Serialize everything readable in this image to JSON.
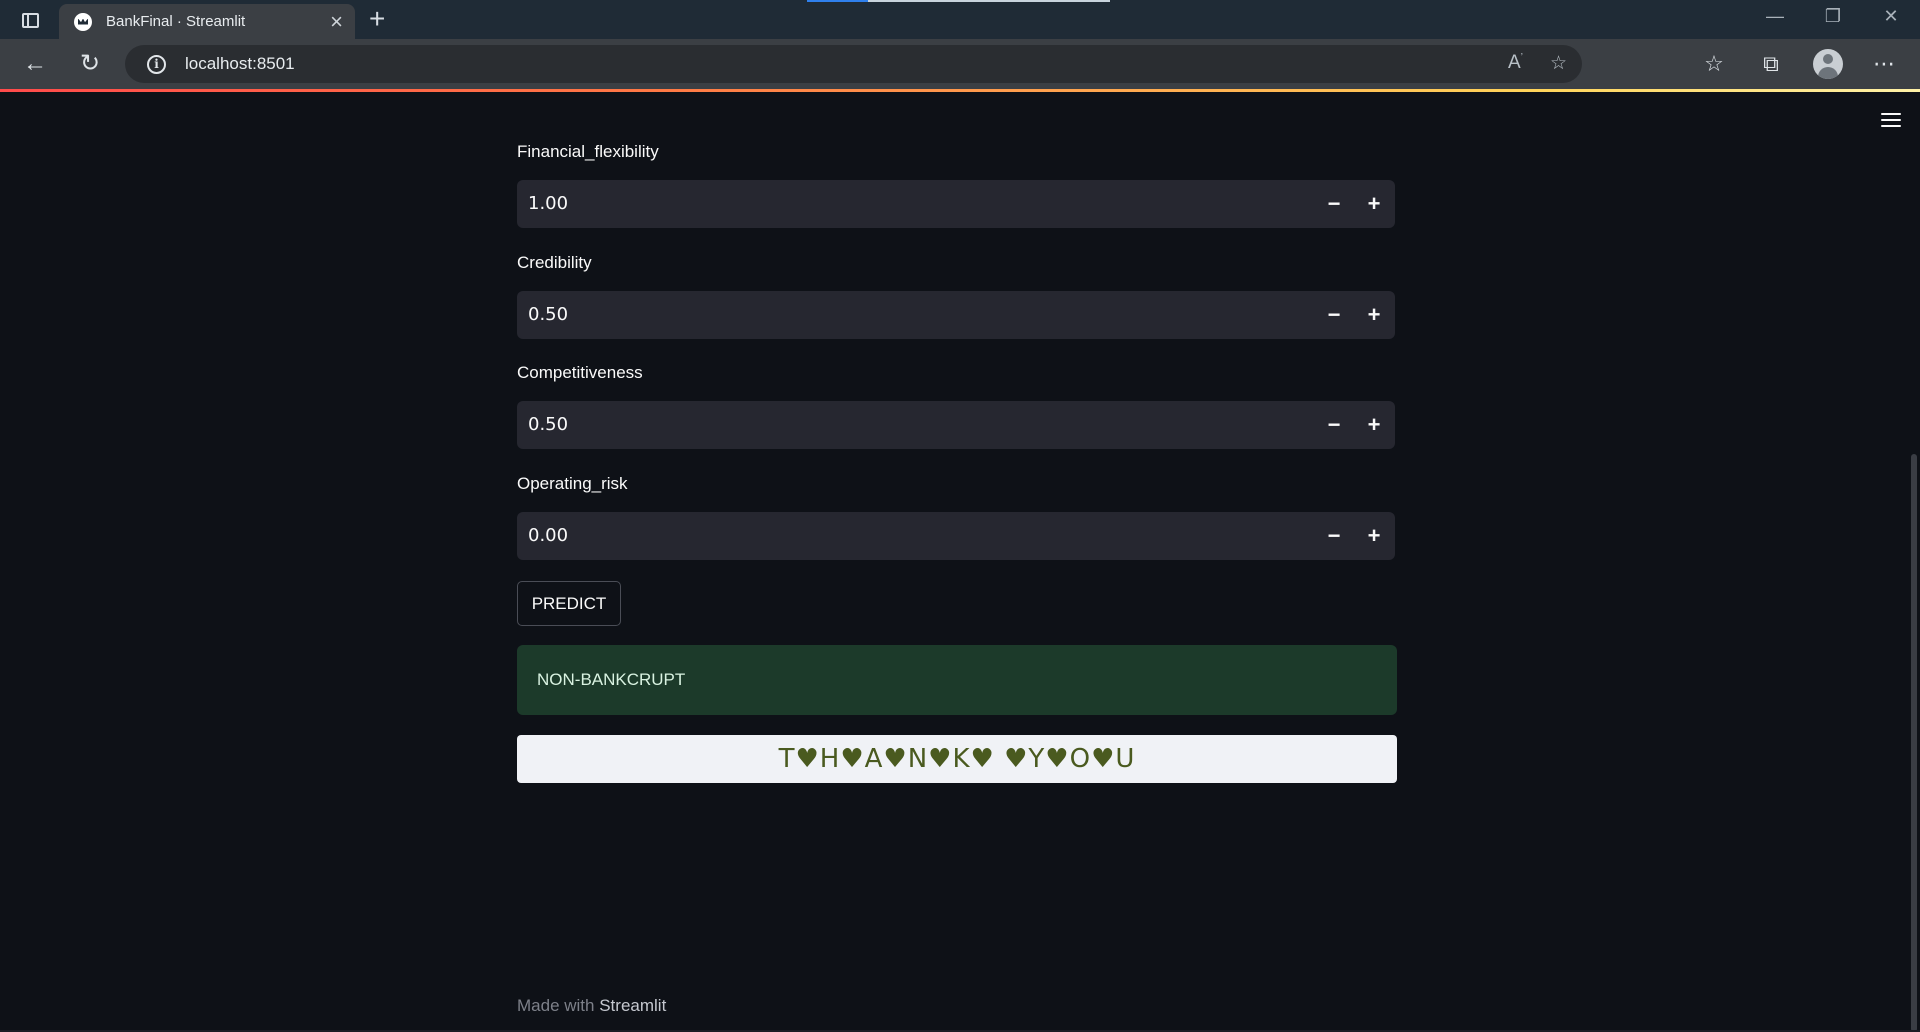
{
  "browser": {
    "tab_title": "BankFinal · Streamlit",
    "tab_close": "×",
    "new_tab": "+",
    "url": "localhost:8501",
    "window": {
      "minimize": "—",
      "restore": "❐",
      "close": "✕"
    }
  },
  "form": {
    "fields": [
      {
        "label": "Financial_flexibility",
        "value": "1.00",
        "minus": "−",
        "plus": "+"
      },
      {
        "label": "Credibility",
        "value": "0.50",
        "minus": "−",
        "plus": "+"
      },
      {
        "label": "Competitiveness",
        "value": "0.50",
        "minus": "−",
        "plus": "+"
      },
      {
        "label": "Operating_risk",
        "value": "0.00",
        "minus": "−",
        "plus": "+"
      }
    ],
    "predict_label": "PREDICT"
  },
  "result": {
    "text": "NON-BANKCRUPT",
    "color": "#1c3a2a"
  },
  "thanks": {
    "text": "T♥H♥A♥N♥K♥ ♥Y♥O♥U"
  },
  "footer": {
    "prefix": "Made with",
    "brand": "Streamlit"
  },
  "icons": {
    "back": "back-arrow-icon",
    "refresh": "refresh-icon",
    "info": "info-icon",
    "read_aloud": "read-aloud-icon",
    "favorite": "add-favorite-icon",
    "favorites": "favorites-icon",
    "collections": "collections-icon",
    "more": "more-icon",
    "menu": "hamburger-menu-icon"
  }
}
